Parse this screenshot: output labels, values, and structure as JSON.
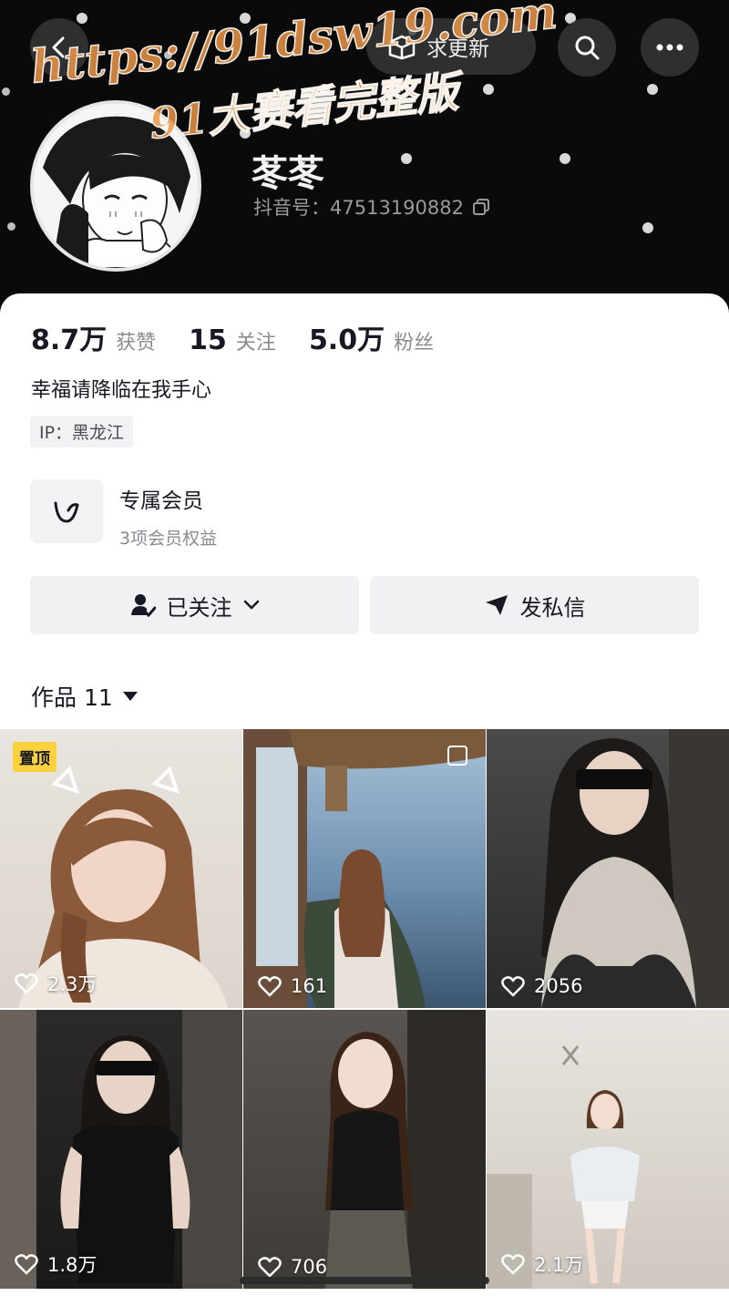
{
  "header": {
    "back_icon": "chevron-left-icon",
    "update_label": "求更新",
    "search_icon": "search-icon",
    "more_icon": "ellipsis-icon"
  },
  "watermark": {
    "line1": "https://91dsw19.com",
    "line2": "91大赛看完整版"
  },
  "profile": {
    "nickname": "苳苳",
    "douyin_id": "抖音号：47513190882"
  },
  "stats": [
    {
      "value": "8.7万",
      "label": "获赞"
    },
    {
      "value": "15",
      "label": "关注"
    },
    {
      "value": "5.0万",
      "label": "粉丝"
    }
  ],
  "bio": "幸福请降临在我手心",
  "ip_tag": "IP：黑龙江",
  "membership": {
    "title": "专属会员",
    "subtitle": "3项会员权益"
  },
  "actions": {
    "follow_label": "已关注",
    "message_label": "发私信"
  },
  "works_tab": {
    "label": "作品 11"
  },
  "videos": [
    {
      "likes": "2.3万",
      "pinned_label": "置顶"
    },
    {
      "likes": "161"
    },
    {
      "likes": "2056"
    },
    {
      "likes": "1.8万"
    },
    {
      "likes": "706"
    },
    {
      "likes": "2.1万"
    }
  ],
  "colors": {
    "header_bg": "#0a0a0a",
    "pin_badge": "#fcd23c",
    "text_primary": "#161823",
    "text_secondary": "#8a8b91"
  }
}
